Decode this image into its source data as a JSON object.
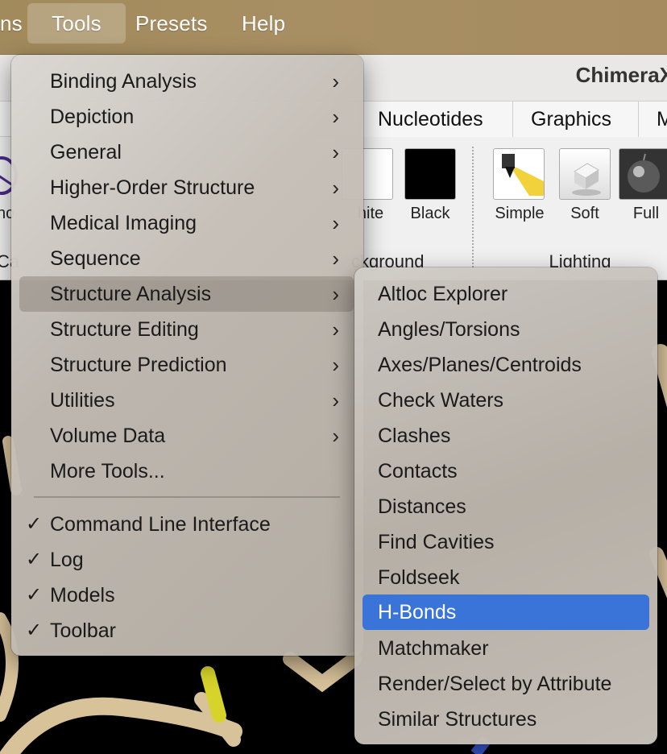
{
  "menubar": {
    "items": [
      {
        "label": "ns",
        "active": false
      },
      {
        "label": "Tools",
        "active": true
      },
      {
        "label": "Presets",
        "active": false
      },
      {
        "label": "Help",
        "active": false
      }
    ]
  },
  "window": {
    "title": "ChimeraX",
    "tabs": [
      "Nucleotides",
      "Graphics",
      "M"
    ],
    "toolbar": {
      "left_labels": [
        "no",
        "Ca"
      ],
      "background_buttons": [
        "hite",
        "Black"
      ],
      "background_group": "ckground",
      "lighting_buttons": [
        "Simple",
        "Soft",
        "Full"
      ],
      "lighting_group": "Lighting"
    }
  },
  "tools_menu": {
    "items": [
      {
        "label": "Binding Analysis",
        "submenu": true
      },
      {
        "label": "Depiction",
        "submenu": true
      },
      {
        "label": "General",
        "submenu": true
      },
      {
        "label": "Higher-Order Structure",
        "submenu": true
      },
      {
        "label": "Medical Imaging",
        "submenu": true
      },
      {
        "label": "Sequence",
        "submenu": true
      },
      {
        "label": "Structure Analysis",
        "submenu": true,
        "highlighted": true
      },
      {
        "label": "Structure Editing",
        "submenu": true
      },
      {
        "label": "Structure Prediction",
        "submenu": true
      },
      {
        "label": "Utilities",
        "submenu": true
      },
      {
        "label": "Volume Data",
        "submenu": true
      },
      {
        "label": "More Tools...",
        "submenu": false
      }
    ],
    "checked_items": [
      {
        "label": "Command Line Interface",
        "checked": true
      },
      {
        "label": "Log",
        "checked": true
      },
      {
        "label": "Models",
        "checked": true
      },
      {
        "label": "Toolbar",
        "checked": true
      }
    ],
    "chevron_glyph": "›",
    "check_glyph": "✓"
  },
  "structure_analysis_submenu": {
    "items": [
      {
        "label": "Altloc Explorer"
      },
      {
        "label": "Angles/Torsions"
      },
      {
        "label": "Axes/Planes/Centroids"
      },
      {
        "label": "Check Waters"
      },
      {
        "label": "Clashes"
      },
      {
        "label": "Contacts"
      },
      {
        "label": "Distances"
      },
      {
        "label": "Find Cavities"
      },
      {
        "label": "Foldseek"
      },
      {
        "label": "H-Bonds",
        "selected": true
      },
      {
        "label": "Matchmaker"
      },
      {
        "label": "Render/Select by Attribute"
      },
      {
        "label": "Similar Structures"
      }
    ]
  },
  "colors": {
    "selection": "#3a74d8",
    "menubar": "#a58b5f",
    "stick": "#d8c29a",
    "highlight_atom": "#d6d42a"
  }
}
